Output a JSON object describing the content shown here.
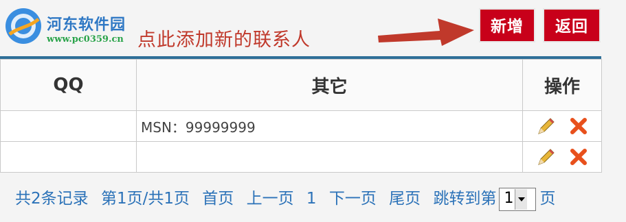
{
  "watermark": {
    "title": "河东软件园",
    "url": "www.pc0359.cn"
  },
  "annotation": "点此添加新的联系人",
  "toolbar": {
    "add_label": "新增",
    "back_label": "返回"
  },
  "table": {
    "headers": [
      "QQ",
      "其它",
      "操作"
    ],
    "rows": [
      {
        "qq": "",
        "other": "MSN：99999999"
      },
      {
        "qq": "",
        "other": ""
      }
    ]
  },
  "pager": {
    "summary": "共2条记录",
    "page_info": "第1页/共1页",
    "first": "首页",
    "prev": "上一页",
    "current": "1",
    "next": "下一页",
    "last": "尾页",
    "jump_label": "跳转到第",
    "selected_page": "1",
    "suffix": "页"
  },
  "icons": {
    "edit": "pencil-icon",
    "delete": "close-icon"
  },
  "colors": {
    "accent": "#c8001a",
    "link": "#2b72b8",
    "annotation": "#c0392b",
    "header_line": "#2e6f98"
  }
}
